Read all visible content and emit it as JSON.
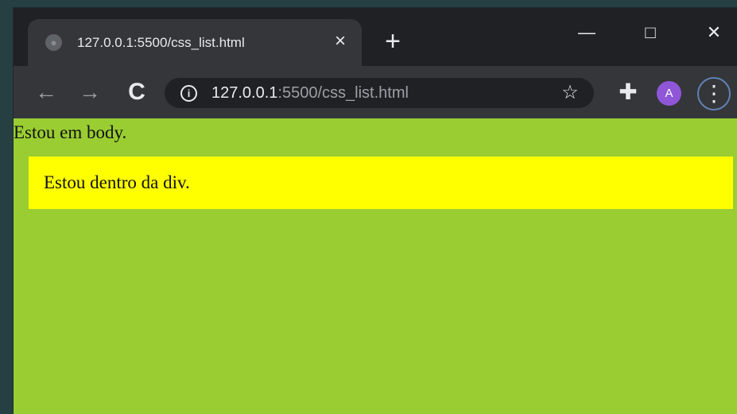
{
  "tab": {
    "title": "127.0.0.1:5500/css_list.html",
    "close_symbol": "×",
    "favicon": "globe-icon"
  },
  "new_tab": {
    "symbol": "+"
  },
  "window_controls": {
    "minimize_symbol": "—",
    "maximize_symbol": "□",
    "close_symbol": "✕"
  },
  "toolbar": {
    "back_symbol": "←",
    "forward_symbol": "→",
    "reload_symbol": "C",
    "info_symbol": "i",
    "url_host": "127.0.0.1",
    "url_rest": ":5500/css_list.html",
    "bookmark_symbol": "☆",
    "extensions_symbol": "✚",
    "profile_initial": "A",
    "menu_symbol": "⋮"
  },
  "page": {
    "body_text": "Estou em body.",
    "div_text": "Estou dentro da div."
  },
  "colors": {
    "body_background": "#9acd32",
    "div_background": "#ffff00",
    "browser_frame": "#202124",
    "toolbar": "#35363a",
    "avatar": "#8f56d8"
  }
}
